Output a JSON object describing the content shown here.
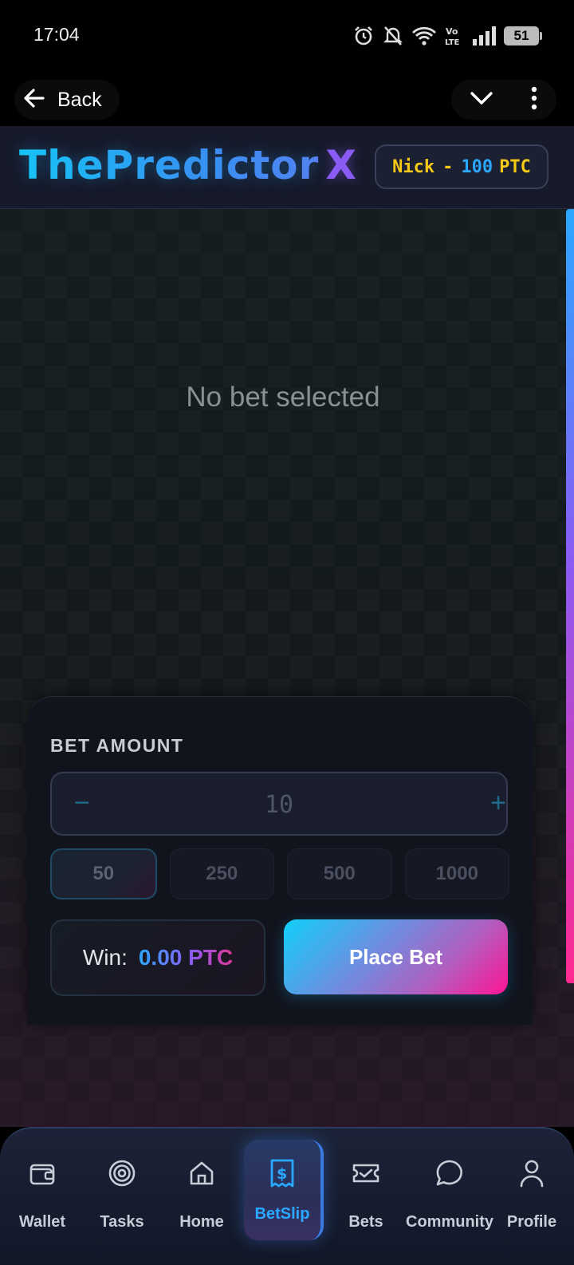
{
  "status_bar": {
    "time": "17:04",
    "battery": "51"
  },
  "toolbar": {
    "back_label": "Back"
  },
  "header": {
    "logo_main": "ThePredictor",
    "logo_accent": "X",
    "user_name": "Nick",
    "separator": "-",
    "balance": "100",
    "unit": "PTC"
  },
  "main": {
    "empty_message": "No bet selected"
  },
  "bet_panel": {
    "label": "BET AMOUNT",
    "minus": "−",
    "plus": "+",
    "amount": "10",
    "presets": [
      "50",
      "250",
      "500",
      "1000"
    ],
    "win_label": "Win:",
    "win_value": "0.00 PTC",
    "place_bet_label": "Place Bet"
  },
  "nav": {
    "items": [
      {
        "label": "Wallet",
        "icon": "wallet-icon"
      },
      {
        "label": "Tasks",
        "icon": "target-icon"
      },
      {
        "label": "Home",
        "icon": "home-icon"
      },
      {
        "label": "BetSlip",
        "icon": "receipt-dollar-icon",
        "active": true
      },
      {
        "label": "Bets",
        "icon": "ticket-check-icon"
      },
      {
        "label": "Community",
        "icon": "chat-bubble-icon"
      },
      {
        "label": "Profile",
        "icon": "user-icon"
      }
    ]
  },
  "colors": {
    "accent_cyan": "#15c8f5",
    "accent_purple": "#8a5cf5",
    "accent_pink": "#ff1493",
    "gold": "#f5c916"
  }
}
